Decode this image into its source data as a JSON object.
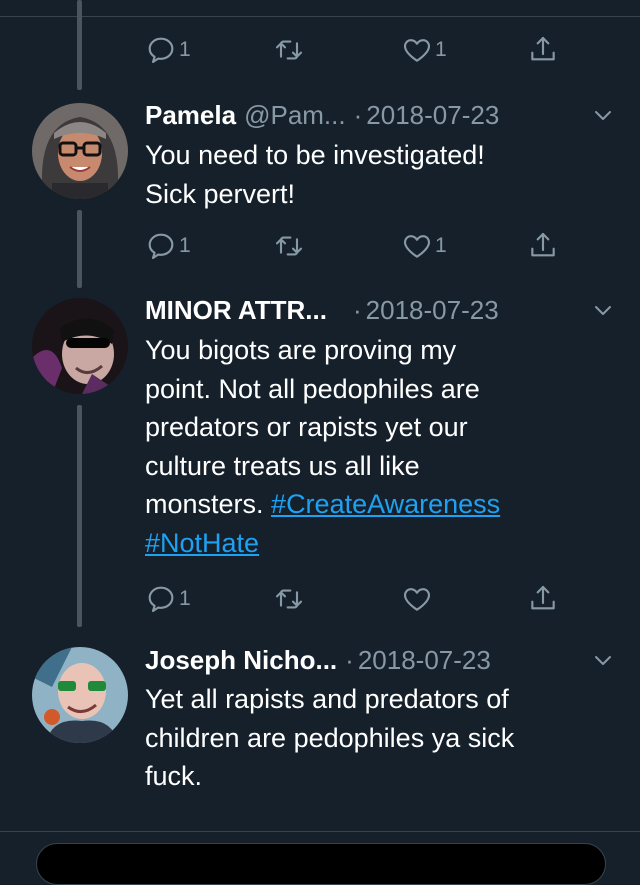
{
  "tweets": [
    {
      "id": "top",
      "actions": {
        "reply_count": "1",
        "retweet_count": "",
        "like_count": "1"
      }
    },
    {
      "id": "pamela",
      "name": "Pamela",
      "handle": "@Pam...",
      "separator": "·",
      "date": "2018-07-23",
      "lines": [
        "You need to be investigated!",
        "Sick pervert!"
      ],
      "actions": {
        "reply_count": "1",
        "retweet_count": "",
        "like_count": "1"
      }
    },
    {
      "id": "minor",
      "name": "MINOR ATTR...",
      "handle": "",
      "separator": "·",
      "date": "2018-07-23",
      "lines": [
        "You bigots are proving my",
        "point. Not all pedophiles are",
        "predators or rapists yet our",
        "culture treats us all like"
      ],
      "line5_text": "monsters. ",
      "hashtags": [
        "#CreateAwareness",
        "#NotHate"
      ],
      "actions": {
        "reply_count": "1",
        "retweet_count": "",
        "like_count": ""
      }
    },
    {
      "id": "joseph",
      "name": "Joseph Nicho...",
      "handle": "",
      "separator": "·",
      "date": "2018-07-23",
      "lines": [
        "Yet all rapists and predators of",
        "children are pedophiles ya sick",
        "fuck."
      ]
    }
  ],
  "icons": {
    "reply": "reply-icon",
    "retweet": "retweet-icon",
    "like": "heart-icon",
    "share": "share-icon",
    "caret": "chevron-down-icon"
  },
  "colors": {
    "background": "#15202b",
    "text": "#ffffff",
    "muted": "#8899a6",
    "link": "#1da1f2",
    "divider": "#38444d"
  }
}
